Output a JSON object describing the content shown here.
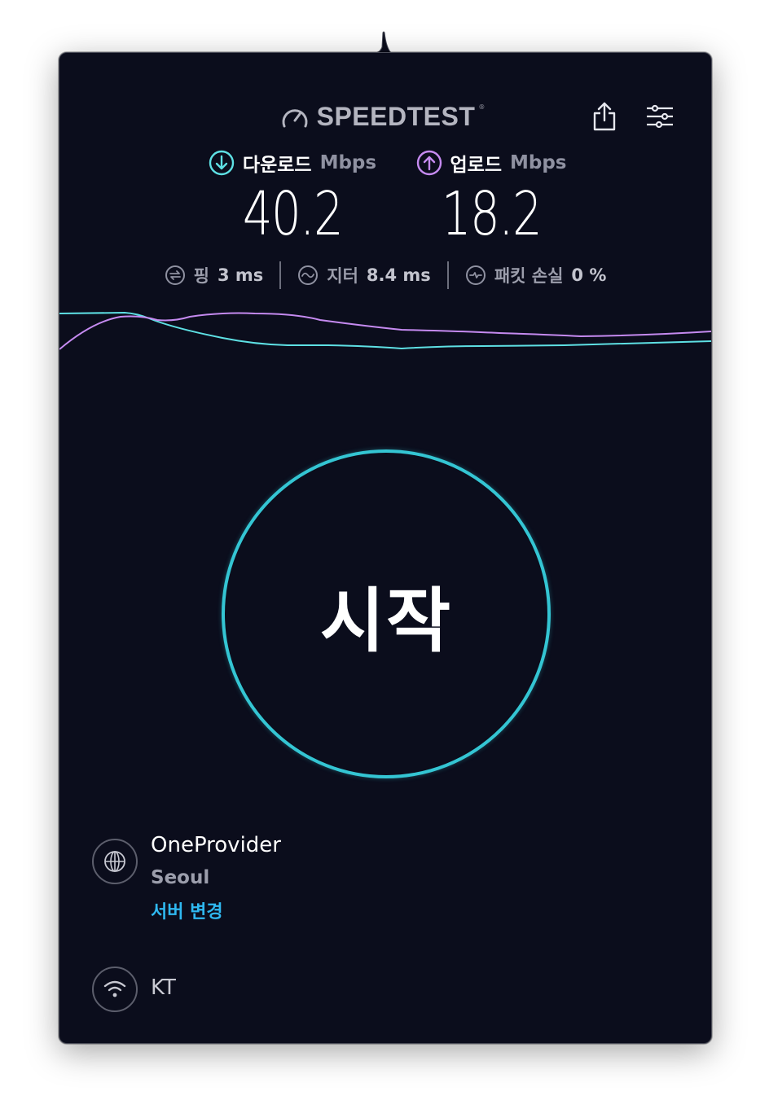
{
  "app": {
    "brand": "SPEEDTEST",
    "trademark": "®",
    "toolbar": {
      "share_icon": "share-icon",
      "settings_icon": "sliders-icon"
    }
  },
  "results": {
    "download": {
      "label": "다운로드",
      "unit": "Mbps",
      "value": "40.2",
      "icon": "download-arrow-icon",
      "color": "#5ee0e4"
    },
    "upload": {
      "label": "업로드",
      "unit": "Mbps",
      "value": "18.2",
      "icon": "upload-arrow-icon",
      "color": "#c58af0"
    }
  },
  "stats": {
    "ping": {
      "label": "핑",
      "value": "3 ms",
      "icon": "ping-icon"
    },
    "jitter": {
      "label": "지터",
      "value": "8.4 ms",
      "icon": "jitter-icon"
    },
    "packet_loss": {
      "label": "패킷 손실",
      "value": "0 %",
      "icon": "packet-loss-icon"
    }
  },
  "start_button": {
    "label": "시작",
    "color": "#34c5d3"
  },
  "server": {
    "name": "OneProvider",
    "city": "Seoul",
    "change_label": "서버 변경",
    "icon": "globe-icon"
  },
  "isp": {
    "name": "KT",
    "icon": "wifi-icon"
  }
}
